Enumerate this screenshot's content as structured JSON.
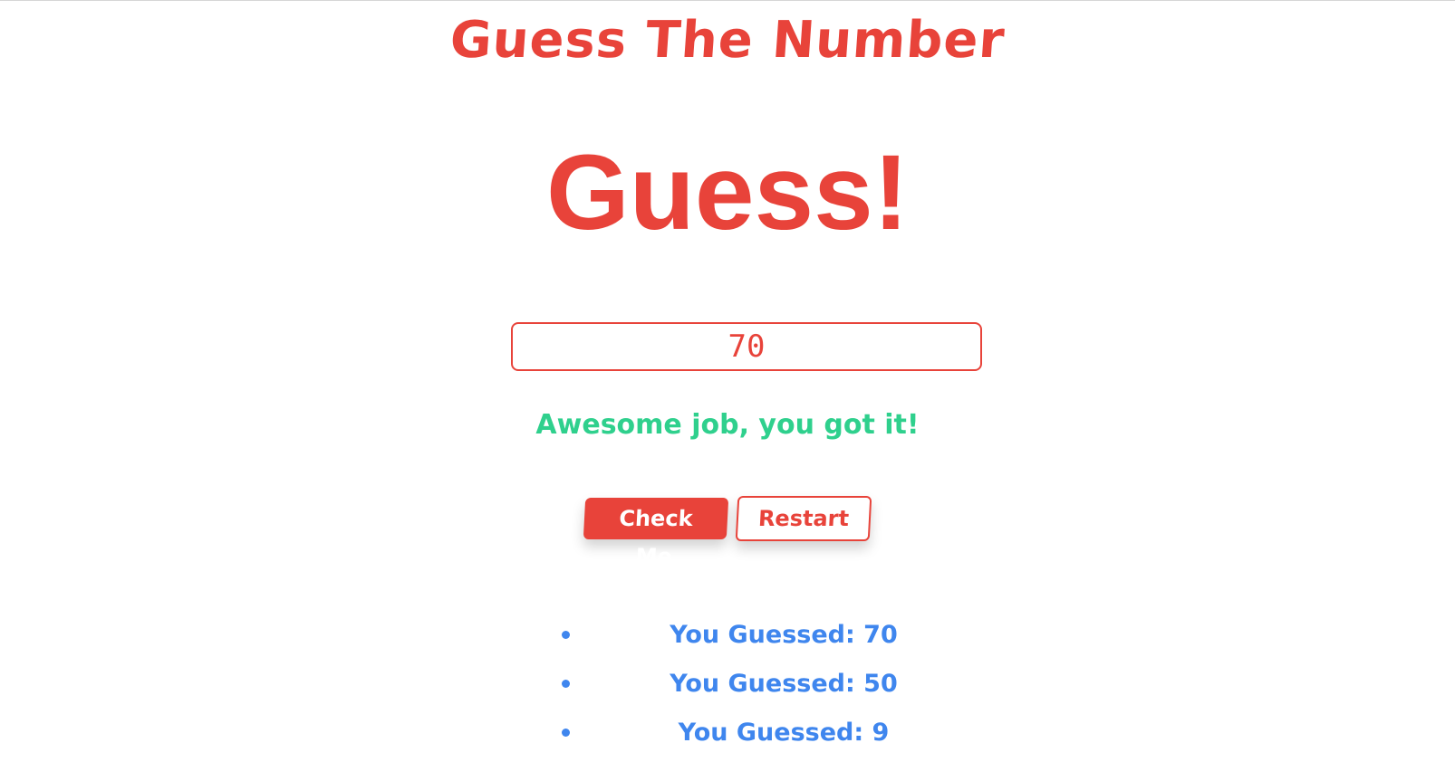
{
  "header": {
    "title": "Guess The Number"
  },
  "main": {
    "heading": "Guess!",
    "guess_input_value": "70",
    "message": "Awesome job, you got it!",
    "message_color": "#2fd08d"
  },
  "buttons": {
    "check_label": "Check Me",
    "restart_label": "Restart"
  },
  "history": [
    "You Guessed: 70",
    "You Guessed: 50",
    "You Guessed: 9"
  ],
  "colors": {
    "accent": "#e8433a",
    "history_text": "#3f86ee"
  }
}
